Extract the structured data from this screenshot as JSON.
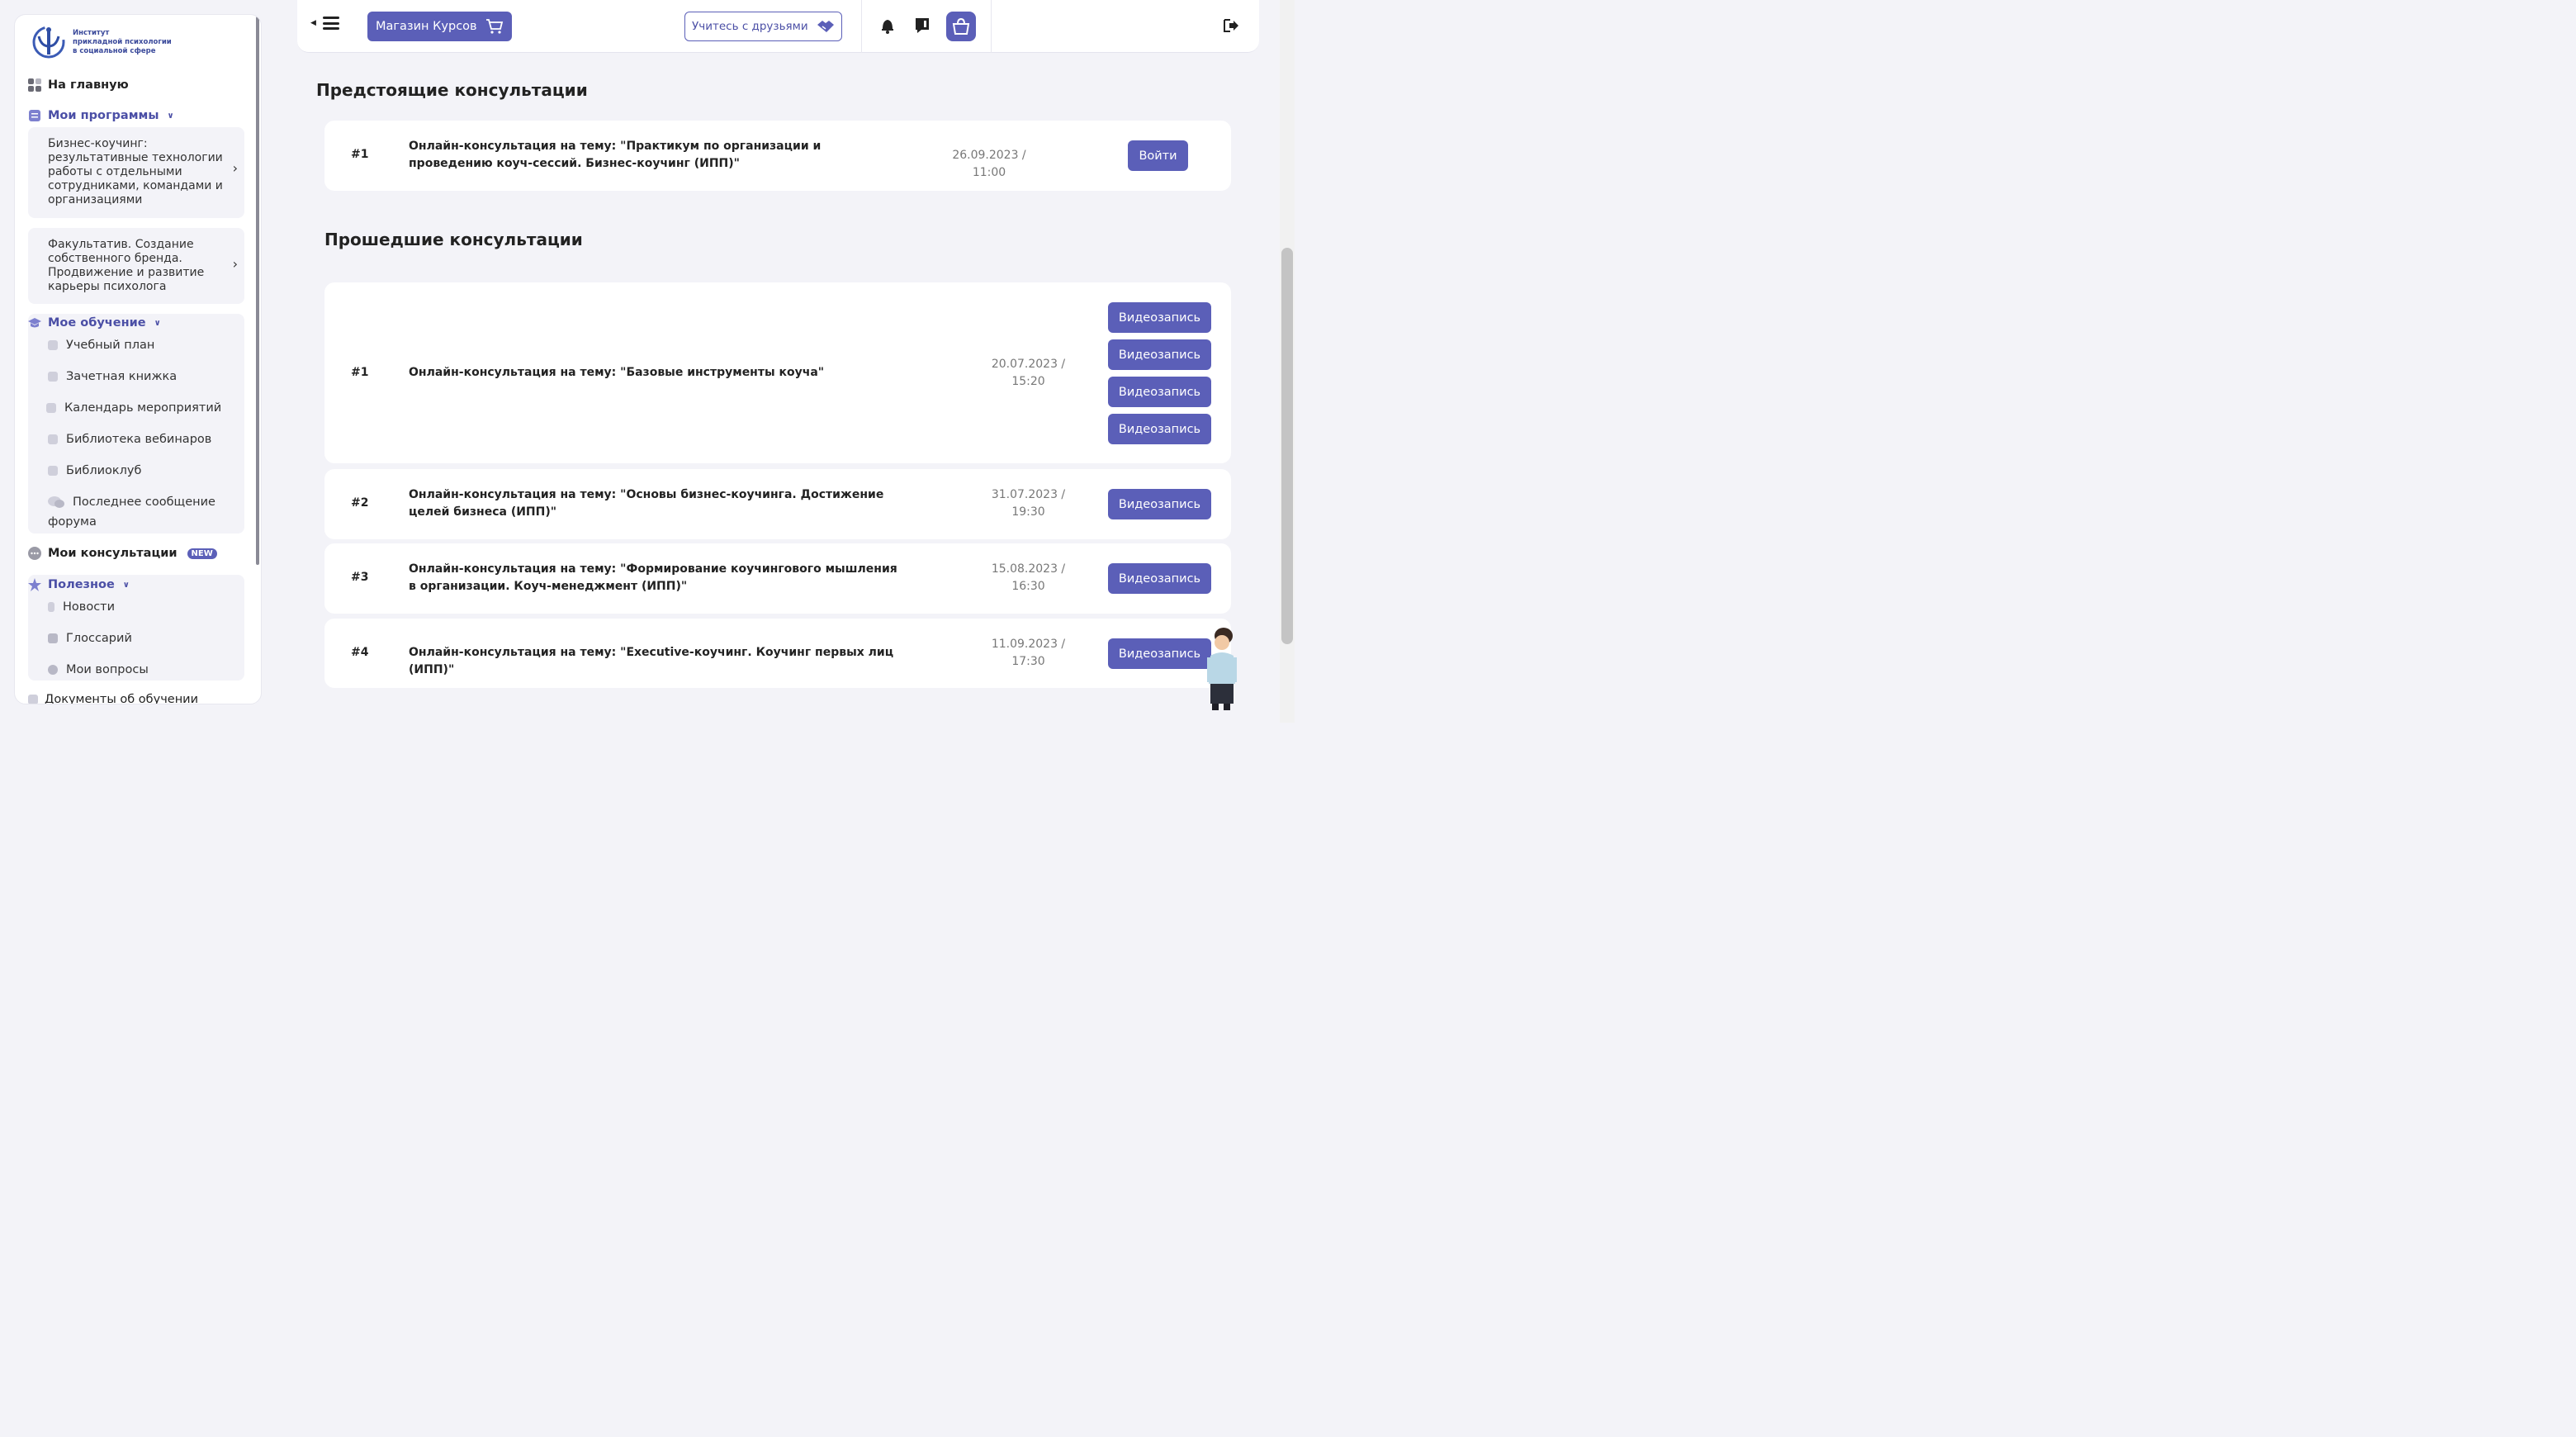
{
  "sidebar": {
    "logo": [
      "Институт",
      "прикладной психологии",
      "в социальной сфере"
    ],
    "home": "На главную",
    "programs_label": "Мои программы",
    "programs": [
      "Бизнес-коучинг: результативные технологии работы с отдельными сотрудниками, командами и организациями",
      "Факультатив. Создание собственного бренда. Продвижение и развитие карьеры психолога"
    ],
    "learning_label": "Мое обучение",
    "learning": [
      "Учебный план",
      "Зачетная книжка",
      "Календарь мероприятий",
      "Библиотека вебинаров",
      "Библиоклуб",
      "Последнее сообщение",
      "форума"
    ],
    "consult_label": "Мои консультации",
    "new_badge": "NEW",
    "useful_label": "Полезное",
    "useful": [
      "Новости",
      "Глоссарий",
      "Мои вопросы"
    ],
    "docs_label": "Документы об обучении"
  },
  "header": {
    "shop": "Магазин Курсов",
    "friends": "Учитесь с друзьями"
  },
  "upcoming": {
    "title": "Предстоящие консультации",
    "items": [
      {
        "num": "#1",
        "title": "Онлайн-консультация на тему: \"Практикум по организации и проведению коуч-сессий. Бизнес-коучинг (ИПП)\"",
        "date": "26.09.2023 / 11:00",
        "button": "Войти"
      }
    ]
  },
  "past": {
    "title": "Прошедшие консультации",
    "button": "Видеозапись",
    "items": [
      {
        "num": "#1",
        "title": "Онлайн-консультация на тему: \"Базовые инструменты коуча\"",
        "date1": "20.07.2023 /",
        "date2": "15:20"
      },
      {
        "num": "#2",
        "title": "Онлайн-консультация на тему: \"Основы бизнес-коучинга. Достижение целей бизнеса (ИПП)\"",
        "date1": "31.07.2023 /",
        "date2": "19:30"
      },
      {
        "num": "#3",
        "title": "Онлайн-консультация на тему: \"Формирование коучингового мышления в организации. Коуч-менеджмент (ИПП)\"",
        "date1": "15.08.2023 /",
        "date2": "16:30"
      },
      {
        "num": "#4",
        "title": "Онлайн-консультация на тему: \"Executive-коучинг. Коучинг первых лиц (ИПП)\"",
        "date1": "11.09.2023 /",
        "date2": "17:30"
      }
    ]
  }
}
